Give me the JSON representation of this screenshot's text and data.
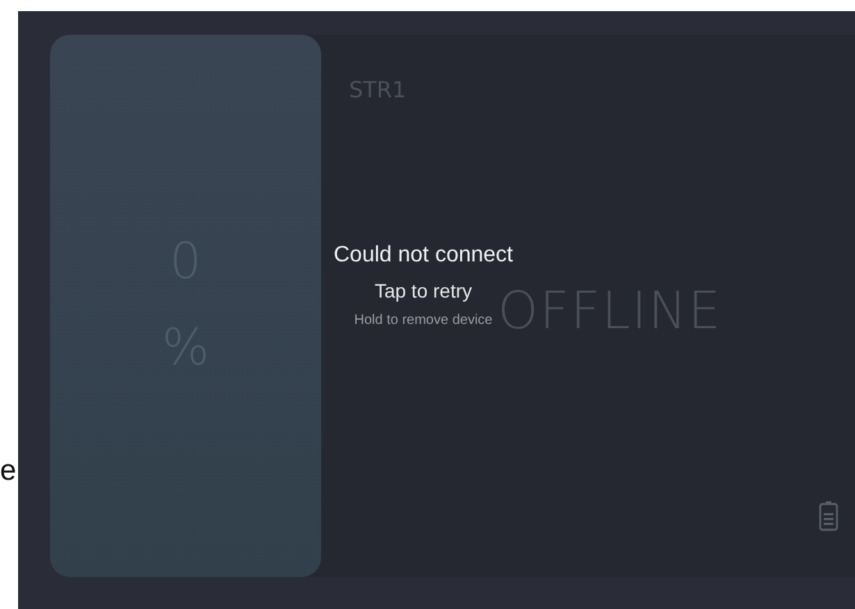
{
  "side_label": "e",
  "device": {
    "name": "STR1",
    "level_value": "0",
    "level_unit": "%",
    "status": "OFFLINE",
    "online": false
  },
  "message": {
    "title": "Could not connect",
    "action": "Tap to retry",
    "hint": "Hold to remove device"
  }
}
